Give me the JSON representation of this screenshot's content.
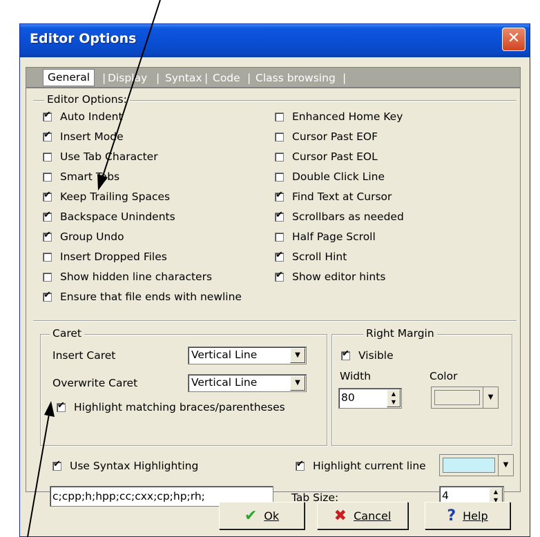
{
  "window": {
    "title": "Editor Options",
    "close_label": "✕"
  },
  "tabs": [
    "General",
    "Display",
    "Syntax",
    "Code",
    "Class browsing"
  ],
  "tab_separator": "|",
  "editor_options": {
    "group_label": "Editor Options:",
    "left": [
      {
        "label": "Auto Indent",
        "checked": true
      },
      {
        "label": "Insert Mode",
        "checked": true
      },
      {
        "label": "Use Tab Character",
        "checked": false
      },
      {
        "label": "Smart Tabs",
        "checked": false
      },
      {
        "label": "Keep Trailing Spaces",
        "checked": true
      },
      {
        "label": "Backspace Unindents",
        "checked": true
      },
      {
        "label": "Group Undo",
        "checked": true
      },
      {
        "label": "Insert Dropped Files",
        "checked": false
      },
      {
        "label": "Show hidden line characters",
        "checked": false
      },
      {
        "label": "Ensure that file ends with newline",
        "checked": true
      }
    ],
    "right": [
      {
        "label": "Enhanced Home Key",
        "checked": false
      },
      {
        "label": "Cursor Past EOF",
        "checked": false
      },
      {
        "label": "Cursor Past EOL",
        "checked": false
      },
      {
        "label": "Double Click Line",
        "checked": false
      },
      {
        "label": "Find Text at Cursor",
        "checked": true
      },
      {
        "label": "Scrollbars as needed",
        "checked": true
      },
      {
        "label": "Half Page Scroll",
        "checked": false
      },
      {
        "label": "Scroll Hint",
        "checked": true
      },
      {
        "label": "Show editor hints",
        "checked": true
      }
    ]
  },
  "caret": {
    "group_label": "Caret",
    "insert_label": "Insert Caret",
    "insert_value": "Vertical Line",
    "overwrite_label": "Overwrite Caret",
    "overwrite_value": "Vertical Line",
    "highlight_braces_label": "Highlight matching braces/parentheses",
    "highlight_braces_checked": true
  },
  "right_margin": {
    "group_label": "Right Margin",
    "visible_label": "Visible",
    "visible_checked": true,
    "width_label": "Width",
    "width_value": "80",
    "color_label": "Color",
    "color_value": "#ece9d8"
  },
  "syntax": {
    "use_highlighting_label": "Use Syntax Highlighting",
    "use_highlighting_checked": true,
    "extensions_value": "c;cpp;h;hpp;cc;cxx;cp;hp;rh;",
    "highlight_line_label": "Highlight current line",
    "highlight_line_checked": true,
    "highlight_line_color": "#c8f0f8",
    "tab_size_label": "Tab Size:",
    "tab_size_value": "4"
  },
  "buttons": {
    "ok_label": "Ok",
    "ok_icon": "check-icon",
    "cancel_label": "Cancel",
    "cancel_icon": "x-icon",
    "help_label": "Help",
    "help_icon": "question-icon"
  },
  "colors": {
    "titlebar": "#0a4fd4",
    "ok_green": "#2ea52e",
    "cancel_red": "#c81e1e",
    "help_blue": "#1c3fb0"
  }
}
